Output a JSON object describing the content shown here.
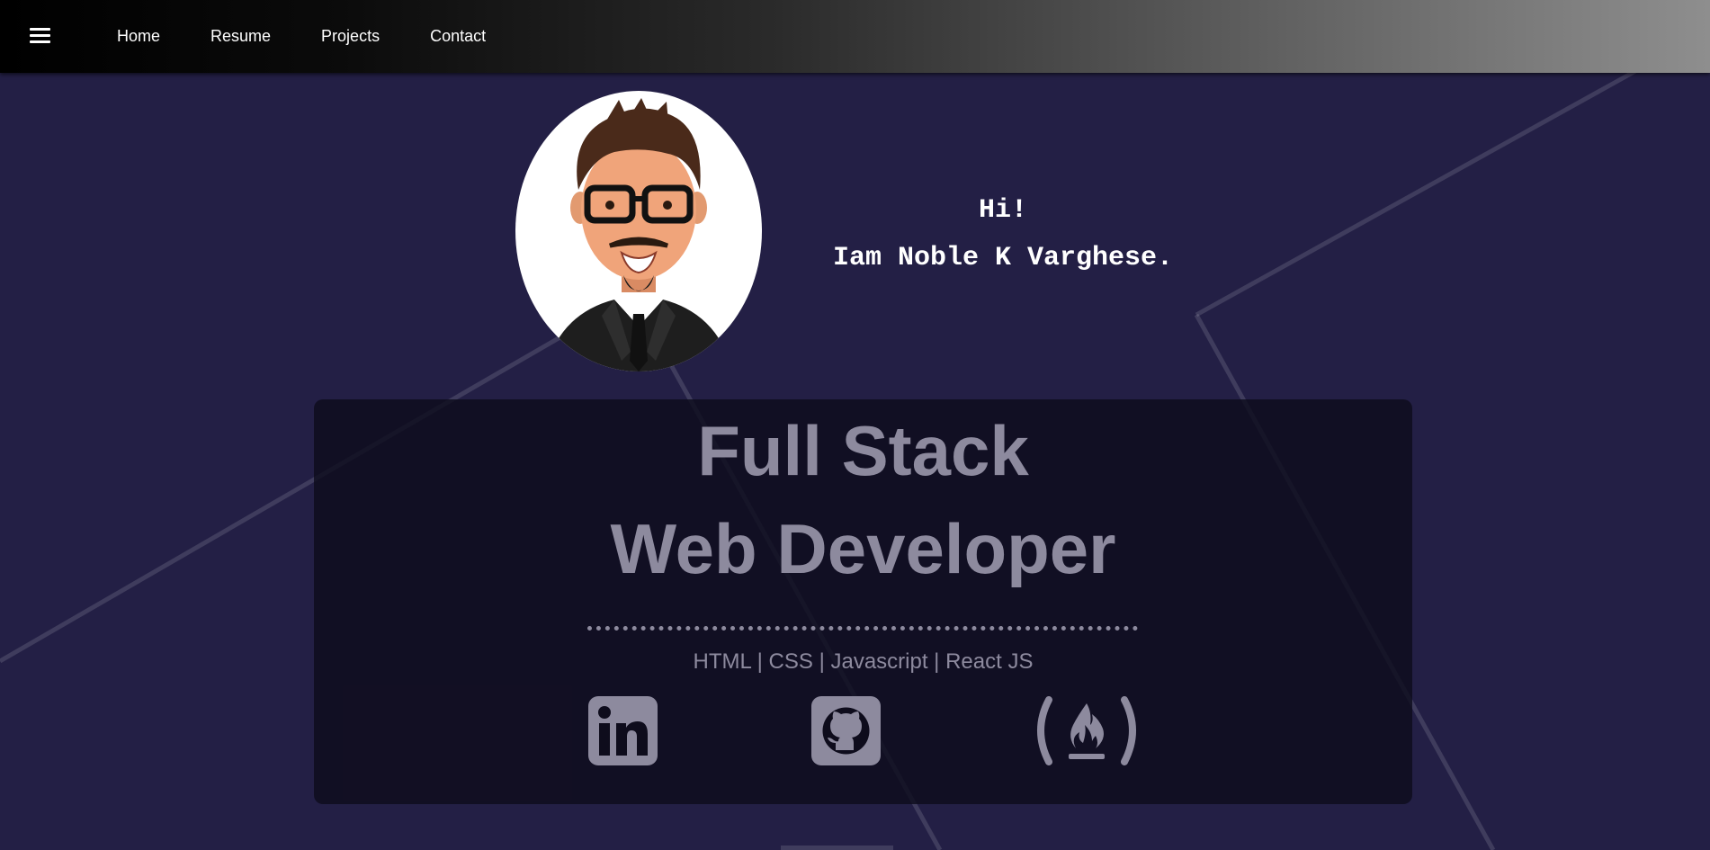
{
  "nav": {
    "menu_icon": "hamburger-menu-icon",
    "links": [
      "Home",
      "Resume",
      "Projects",
      "Contact"
    ]
  },
  "hero": {
    "avatar_alt": "cartoon-portrait",
    "greeting_line1": "Hi!",
    "greeting_line2": "Iam Noble K Varghese."
  },
  "card": {
    "title_line1": "Full Stack",
    "title_line2": "Web Developer",
    "skills": "HTML | CSS | Javascript | React JS",
    "social": [
      {
        "icon": "linkedin-icon"
      },
      {
        "icon": "github-icon"
      },
      {
        "icon": "freecodecamp-icon"
      }
    ]
  },
  "colors": {
    "background": "#231f45",
    "card": "#0e0c1c",
    "muted_text": "#8d8a9e",
    "white": "#ffffff"
  }
}
